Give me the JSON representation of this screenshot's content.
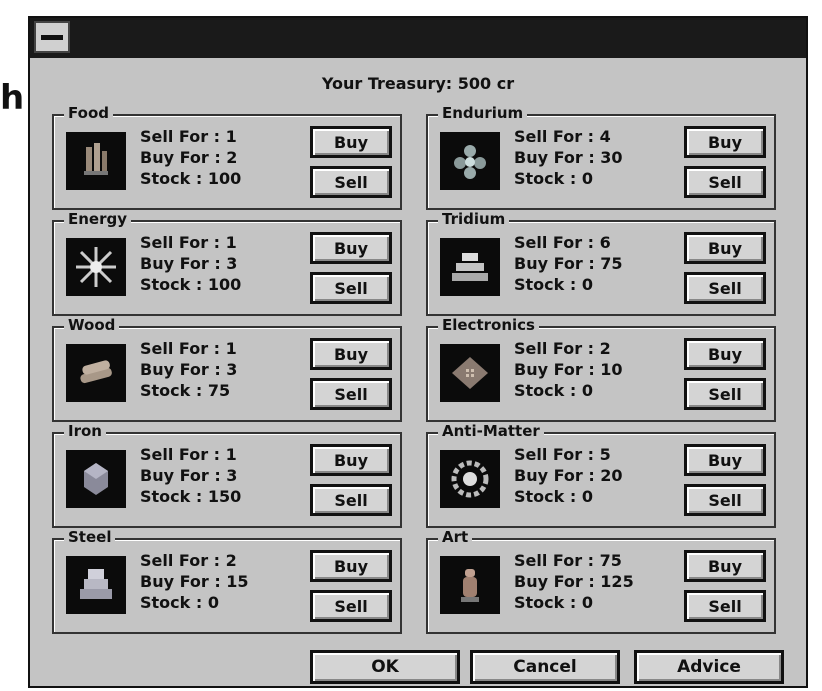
{
  "margin_char": "h",
  "treasury": "Your Treasury: 500 cr",
  "labels": {
    "sell_for": "Sell For :",
    "buy_for": "Buy For :",
    "stock": "Stock :"
  },
  "buttons": {
    "buy": "Buy",
    "sell": "Sell"
  },
  "goods": [
    {
      "name": "Food",
      "sell_for": "1",
      "buy_for": "2",
      "stock": "100",
      "icon": "food-icon"
    },
    {
      "name": "Energy",
      "sell_for": "1",
      "buy_for": "3",
      "stock": "100",
      "icon": "energy-icon"
    },
    {
      "name": "Wood",
      "sell_for": "1",
      "buy_for": "3",
      "stock": "75",
      "icon": "wood-icon"
    },
    {
      "name": "Iron",
      "sell_for": "1",
      "buy_for": "3",
      "stock": "150",
      "icon": "iron-icon"
    },
    {
      "name": "Steel",
      "sell_for": "2",
      "buy_for": "15",
      "stock": "0",
      "icon": "steel-icon"
    },
    {
      "name": "Endurium",
      "sell_for": "4",
      "buy_for": "30",
      "stock": "0",
      "icon": "endurium-icon"
    },
    {
      "name": "Tridium",
      "sell_for": "6",
      "buy_for": "75",
      "stock": "0",
      "icon": "tridium-icon"
    },
    {
      "name": "Electronics",
      "sell_for": "2",
      "buy_for": "10",
      "stock": "0",
      "icon": "electronics-icon"
    },
    {
      "name": "Anti-Matter",
      "sell_for": "5",
      "buy_for": "20",
      "stock": "0",
      "icon": "anti-matter-icon"
    },
    {
      "name": "Art",
      "sell_for": "75",
      "buy_for": "125",
      "stock": "0",
      "icon": "art-icon"
    }
  ],
  "dialog_buttons": {
    "ok": "OK",
    "cancel": "Cancel",
    "advice": "Advice"
  }
}
